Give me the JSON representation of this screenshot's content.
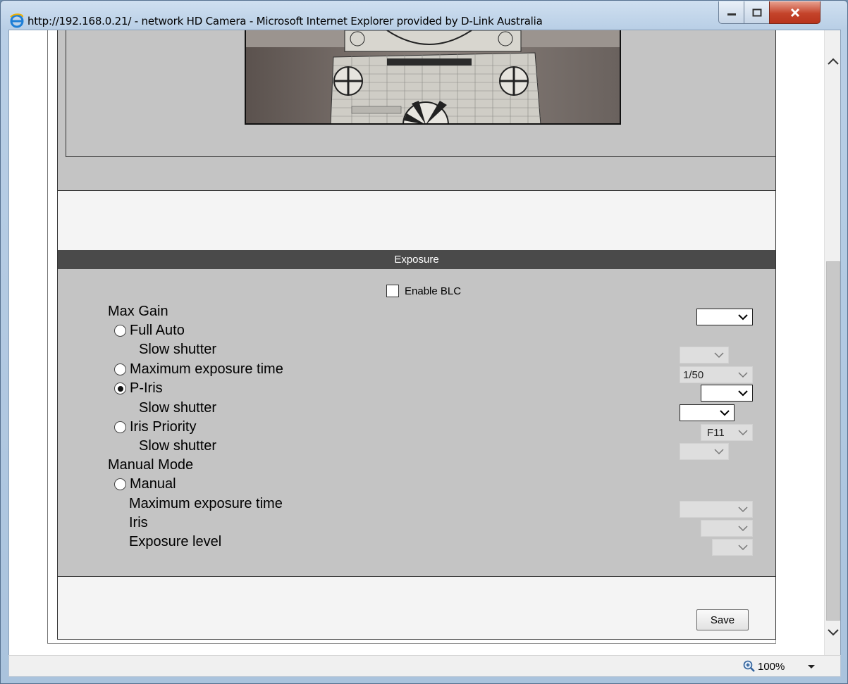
{
  "window": {
    "title": "http://192.168.0.21/ - network HD Camera - Microsoft Internet Explorer provided by D-Link Australia"
  },
  "exposure": {
    "header": "Exposure",
    "enable_blc_label": "Enable BLC",
    "enable_blc_checked": false,
    "rows": {
      "max_gain": "Max Gain",
      "full_auto": "Full Auto",
      "full_auto_slow_shutter": "Slow shutter",
      "max_exposure_time": "Maximum exposure time",
      "max_exposure_time_value": "1/50",
      "p_iris": "P-Iris",
      "p_iris_slow_shutter": "Slow shutter",
      "iris_priority": "Iris Priority",
      "iris_priority_value": "F11",
      "iris_priority_slow_shutter": "Slow shutter",
      "manual_mode": "Manual Mode",
      "manual": "Manual",
      "manual_max_exposure_time": "Maximum exposure time",
      "manual_iris": "Iris",
      "manual_exposure_level": "Exposure level"
    },
    "selected_mode": "P-Iris"
  },
  "actions": {
    "save_label": "Save"
  },
  "statusbar": {
    "zoom": "100%"
  },
  "colors": {
    "panel_gray": "#c4c4c4",
    "header_dark": "#4a4a4a",
    "close_red": "#c4442b"
  }
}
